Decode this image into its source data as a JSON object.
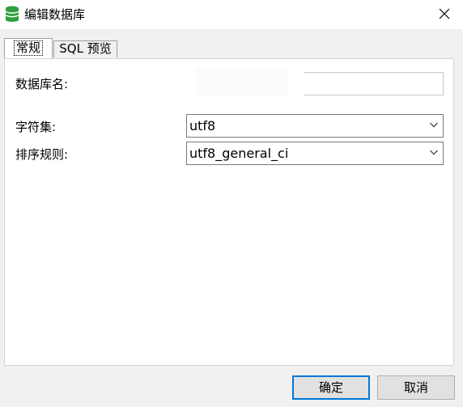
{
  "window": {
    "title": "编辑数据库",
    "icon": "database-icon",
    "close_icon": "close-icon"
  },
  "tabs": [
    {
      "label": "常规",
      "active": true
    },
    {
      "label": "SQL 预览",
      "active": false
    }
  ],
  "form": {
    "db_name_label": "数据库名:",
    "db_name_value": "",
    "charset_label": "字符集:",
    "charset_value": "utf8",
    "collation_label": "排序规则:",
    "collation_value": "utf8_general_ci"
  },
  "buttons": {
    "ok": "确定",
    "cancel": "取消"
  },
  "colors": {
    "accent": "#0078d7",
    "icon_green": "#2e9e3f"
  }
}
